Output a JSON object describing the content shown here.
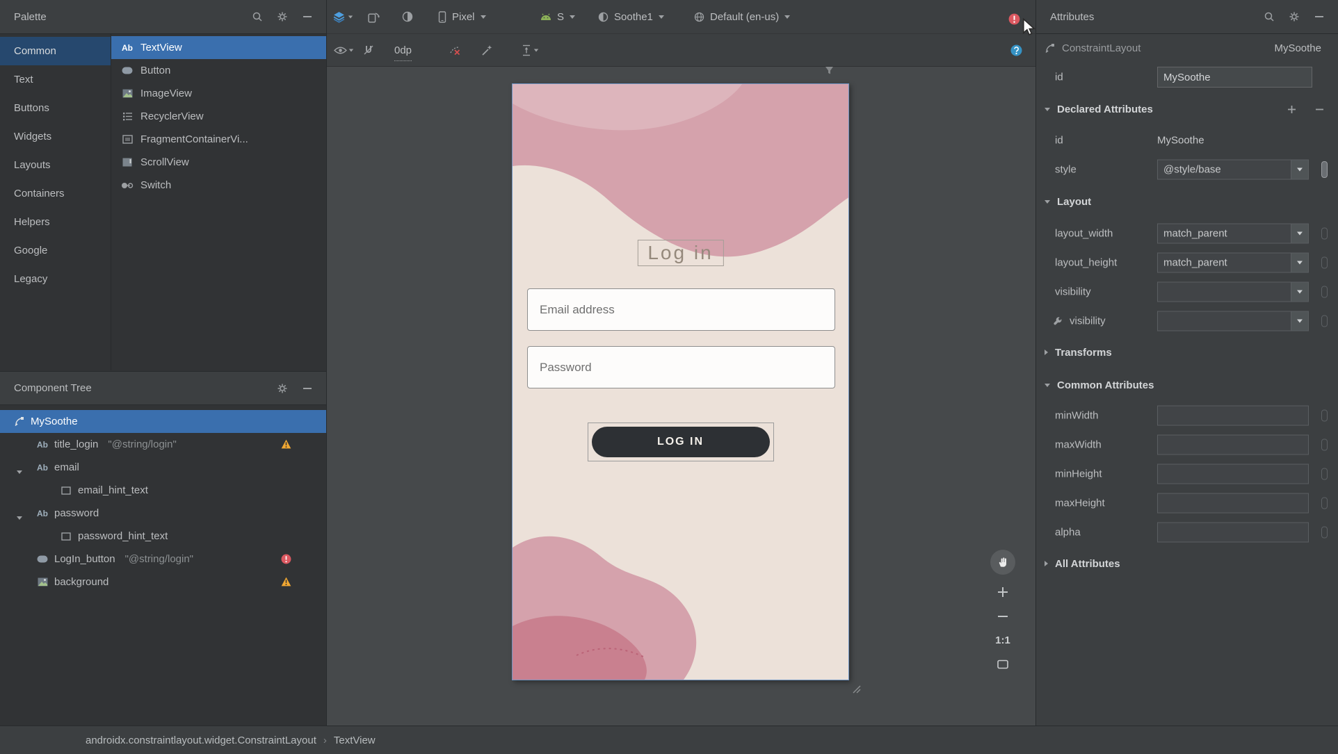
{
  "icons": {
    "textview_glyph": "Ab"
  },
  "palette": {
    "title": "Palette",
    "categories": [
      "Common",
      "Text",
      "Buttons",
      "Widgets",
      "Layouts",
      "Containers",
      "Helpers",
      "Google",
      "Legacy"
    ],
    "items": [
      "TextView",
      "Button",
      "ImageView",
      "RecyclerView",
      "FragmentContainerVi...",
      "ScrollView",
      "Switch"
    ]
  },
  "component_tree": {
    "title": "Component Tree",
    "items": [
      {
        "label": "MySoothe"
      },
      {
        "label": "title_login",
        "value": "\"@string/login\""
      },
      {
        "label": "email"
      },
      {
        "label": "email_hint_text"
      },
      {
        "label": "password"
      },
      {
        "label": "password_hint_text"
      },
      {
        "label": "LogIn_button",
        "value": "\"@string/login\""
      },
      {
        "label": "background"
      }
    ]
  },
  "design_toolbar": {
    "device": "Pixel",
    "api_version": "S",
    "theme": "Soothe1",
    "locale": "Default (en-us)",
    "default_margin": "0dp"
  },
  "design": {
    "title": "Log in",
    "email_hint": "Email address",
    "password_hint": "Password",
    "login_button": "LOG IN"
  },
  "zoom_controls": {
    "actual_size": "1:1"
  },
  "attributes": {
    "title": "Attributes",
    "component_type": "ConstraintLayout",
    "component_id": "MySoothe",
    "id_row": {
      "name": "id",
      "value": "MySoothe"
    },
    "declared": {
      "title": "Declared Attributes",
      "rows": [
        {
          "name": "id",
          "value": "MySoothe"
        },
        {
          "name": "style",
          "value": "@style/base"
        }
      ]
    },
    "layout": {
      "title": "Layout",
      "rows": [
        {
          "name": "layout_width",
          "value": "match_parent"
        },
        {
          "name": "layout_height",
          "value": "match_parent"
        },
        {
          "name": "visibility",
          "value": ""
        },
        {
          "name": "visibility",
          "value": ""
        }
      ]
    },
    "transforms": {
      "title": "Transforms"
    },
    "common": {
      "title": "Common Attributes",
      "rows": [
        {
          "name": "minWidth"
        },
        {
          "name": "maxWidth"
        },
        {
          "name": "minHeight"
        },
        {
          "name": "maxHeight"
        },
        {
          "name": "alpha"
        }
      ]
    },
    "all": {
      "title": "All Attributes"
    }
  },
  "statusbar": {
    "separator": "›",
    "breadcrumbs": [
      "androidx.constraintlayout.widget.ConstraintLayout",
      "TextView"
    ]
  }
}
